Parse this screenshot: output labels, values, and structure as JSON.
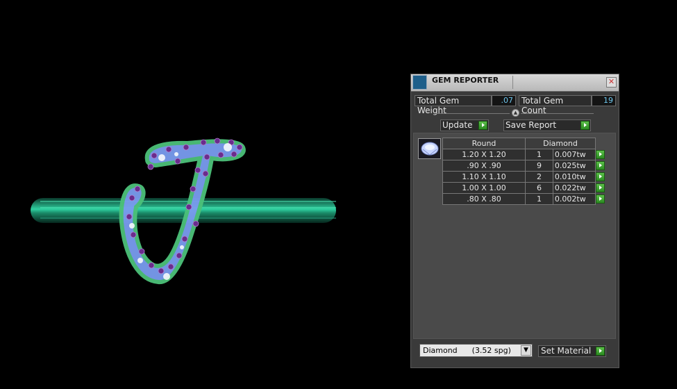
{
  "panel": {
    "title": "GEM REPORTER",
    "title_icon": "gem-report-icon",
    "close_icon": "close-icon",
    "close_glyph": "✕",
    "total_weight_label": "Total Gem Weight",
    "total_weight_value": ".07",
    "total_count_label": "Total Gem Count",
    "total_count_value": "19",
    "update_label": "Update",
    "save_report_label": "Save Report",
    "table": {
      "shape_header": "Round",
      "material_header": "Diamond",
      "rows": [
        {
          "size": "1.20 X 1.20",
          "count": "1",
          "weight": "0.007tw"
        },
        {
          "size": ".90 X .90",
          "count": "9",
          "weight": "0.025tw"
        },
        {
          "size": "1.10 X 1.10",
          "count": "2",
          "weight": "0.010tw"
        },
        {
          "size": "1.00 X 1.00",
          "count": "6",
          "weight": "0.022tw"
        },
        {
          "size": ".80 X .80",
          "count": "1",
          "weight": "0.002tw"
        }
      ]
    },
    "material_select": "Diamond      (3.52 spg)",
    "set_material_label": "Set Material"
  },
  "colors": {
    "accent_green": "#3aa52c",
    "value_blue": "#6ec8f0",
    "gem_purple": "#6a2c8c",
    "letter_blue": "#8fb0ff",
    "shank_teal": "#1f9a78"
  }
}
